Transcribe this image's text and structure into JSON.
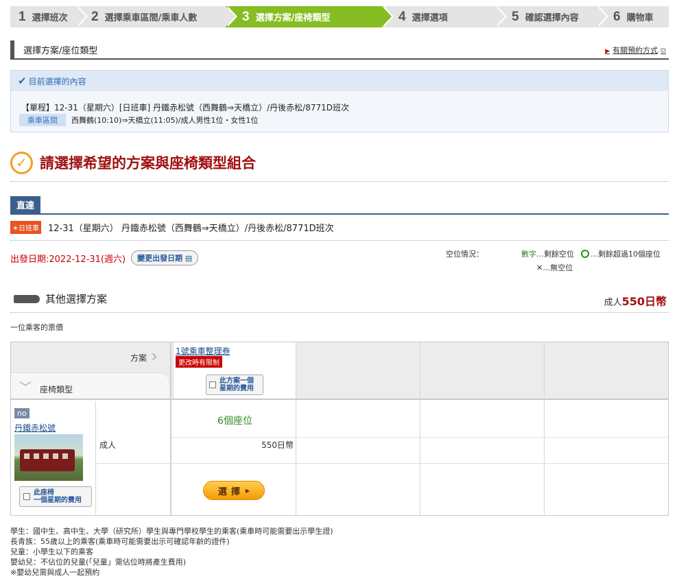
{
  "steps": [
    {
      "num": "1",
      "label": "選擇班次"
    },
    {
      "num": "2",
      "label": "選擇乘車區間/乘車人數"
    },
    {
      "num": "3",
      "label": "選擇方案/座椅類型"
    },
    {
      "num": "4",
      "label": "選擇選項"
    },
    {
      "num": "5",
      "label": "確認選擇內容"
    },
    {
      "num": "6",
      "label": "購物車"
    }
  ],
  "section": {
    "title": "選擇方案/座位類型",
    "help_link": "有關預約方式"
  },
  "current": {
    "title": "目前選擇的內容",
    "line1": "【單程】12-31（星期六）[日班車] 丹鐵赤松號（西舞鶴⇒天橋立）/丹後赤松/8771D班次",
    "tag": "乘車區間",
    "line2": "西舞鶴(10:10)⇒天橋立(11:05)/成人男性1位・女性1位"
  },
  "main_title": "請選擇希望的方案與座椅類型組合",
  "direct": {
    "tab": "直達",
    "day_badge": "日班車",
    "train_text": "12-31（星期六） 丹鐵赤松號（西舞鶴⇒天橋立）/丹後赤松/8771D班次"
  },
  "departure": {
    "label": "出發日期:2022-12-31(週六)",
    "change_button": "變更出發日期"
  },
  "availability": {
    "title": "空位情況：",
    "legend_num_label": "數字",
    "legend_num_desc": "…剩餘空位",
    "legend_circle_desc": "…剩餘超過10個座位",
    "legend_x_desc": "…無空位"
  },
  "other_plans": {
    "title": "其他選擇方案",
    "price_prefix": "成人",
    "price": "550日幣"
  },
  "per_person": "一位乘客的票價",
  "table": {
    "plan_header": "方案",
    "seat_type_header": "座椅類型",
    "plan_link": "1號乘車整理券",
    "limit_badge": "更改時有限制",
    "plan_week_btn_1": "此方案一個",
    "plan_week_btn_2": "星期的費用",
    "seat_badge": "no",
    "train_name": "丹鐵赤松號",
    "seat_week_btn_1": "此座椅",
    "seat_week_btn_2": "一個星期的費用",
    "adult_label": "成人",
    "seats_available": "6個座位",
    "price": "550日幣",
    "select_button": "選擇"
  },
  "notes": [
    "學生：國中生、高中生、大學（研究所）學生與專門學校學生的乘客(乘車時可能需要出示學生證)",
    "長青族：55歲以上的乘客(乘車時可能需要出示可確認年齡的證件)",
    "兒童：小學生以下的乘客",
    "嬰幼兒：不佔位的兒童(「兒童」需佔位時將產生費用)",
    "※嬰幼兒需與成人一起預約"
  ],
  "colors": {
    "accent_green": "#86bd22",
    "title_red": "#a01010",
    "navy": "#3b5f8a",
    "link_blue": "#1a4a8a"
  }
}
